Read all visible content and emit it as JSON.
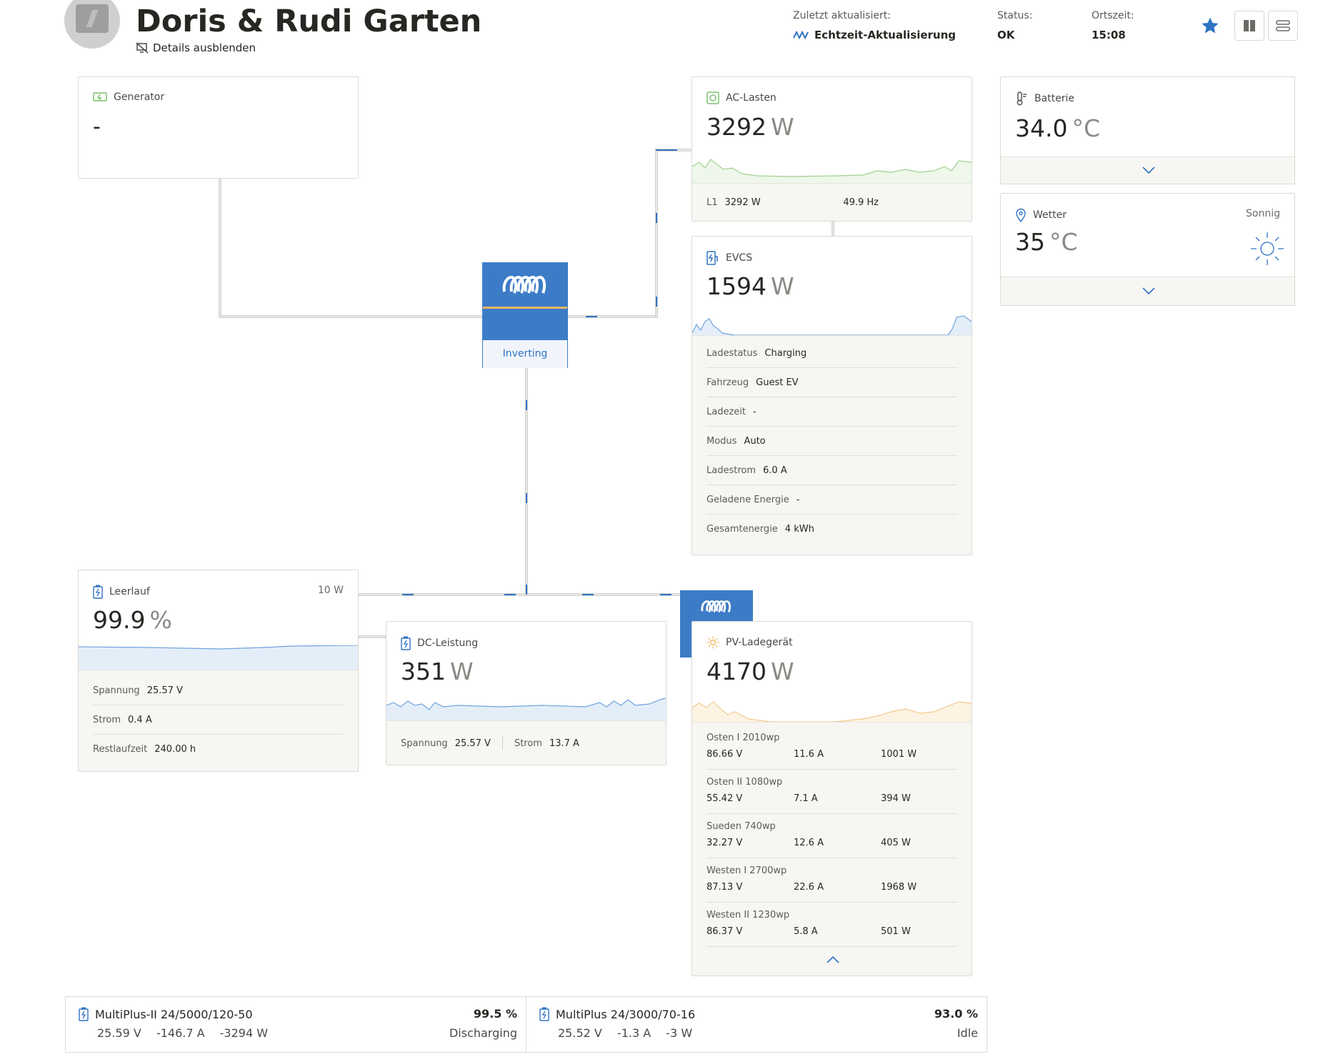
{
  "header": {
    "title": "Doris & Rudi Garten",
    "details_toggle": "Details ausblenden",
    "last_updated_label": "Zuletzt aktualisiert:",
    "last_updated_value": "Echtzeit-Aktualisierung",
    "status_label": "Status:",
    "status_value": "OK",
    "localtime_label": "Ortszeit:",
    "localtime_value": "15:08"
  },
  "generator": {
    "title": "Generator",
    "value": "-"
  },
  "ac_loads": {
    "title": "AC-Lasten",
    "value": "3292",
    "unit": "W",
    "phase_label": "L1",
    "phase_power": "3292 W",
    "frequency": "49.9 Hz"
  },
  "evcs": {
    "title": "EVCS",
    "value": "1594",
    "unit": "W",
    "rows": [
      {
        "k": "Ladestatus",
        "v": "Charging"
      },
      {
        "k": "Fahrzeug",
        "v": "Guest EV"
      },
      {
        "k": "Ladezeit",
        "v": "-"
      },
      {
        "k": "Modus",
        "v": "Auto"
      },
      {
        "k": "Ladestrom",
        "v": "6.0 A"
      },
      {
        "k": "Geladene Energie",
        "v": "-"
      },
      {
        "k": "Gesamtenergie",
        "v": "4 kWh"
      }
    ]
  },
  "inverter": {
    "state": "Inverting"
  },
  "battery_temp": {
    "title": "Batterie",
    "value": "34.0",
    "unit": "°C"
  },
  "weather": {
    "title": "Wetter",
    "condition": "Sonnig",
    "value": "35",
    "unit": "°C"
  },
  "battery": {
    "title": "Leerlauf",
    "power": "10 W",
    "value": "99.9",
    "unit": "%",
    "rows": [
      {
        "k": "Spannung",
        "v": "25.57 V"
      },
      {
        "k": "Strom",
        "v": "0.4 A"
      },
      {
        "k": "Restlaufzeit",
        "v": "240.00 h"
      }
    ]
  },
  "dc_power": {
    "title": "DC-Leistung",
    "value": "351",
    "unit": "W",
    "voltage_label": "Spannung",
    "voltage": "25.57 V",
    "current_label": "Strom",
    "current": "13.7 A"
  },
  "pv_charger": {
    "title": "PV-Ladegerät",
    "value": "4170",
    "unit": "W",
    "trackers": [
      {
        "name": "Osten I 2010wp",
        "voltage": "86.66 V",
        "current": "11.6 A",
        "power": "1001 W"
      },
      {
        "name": "Osten II 1080wp",
        "voltage": "55.42 V",
        "current": "7.1 A",
        "power": "394 W"
      },
      {
        "name": "Sueden 740wp",
        "voltage": "32.27 V",
        "current": "12.6 A",
        "power": "405 W"
      },
      {
        "name": "Westen I 2700wp",
        "voltage": "87.13 V",
        "current": "22.6 A",
        "power": "1968 W"
      },
      {
        "name": "Westen II 1230wp",
        "voltage": "86.37 V",
        "current": "5.8 A",
        "power": "501 W"
      }
    ]
  },
  "devices": [
    {
      "name": "MultiPlus-II 24/5000/120-50",
      "voltage": "25.59 V",
      "current": "-146.7 A",
      "power": "-3294 W",
      "soc": "99.5 %",
      "state": "Discharging"
    },
    {
      "name": "MultiPlus 24/3000/70-16",
      "voltage": "25.52 V",
      "current": "-1.3 A",
      "power": "-3 W",
      "soc": "93.0 %",
      "state": "Idle"
    }
  ],
  "icons": {
    "generator": "generator-icon",
    "ac_loads": "ac-loads-icon",
    "evcs": "ev-charger-icon",
    "battery_temp": "thermometer-icon",
    "weather": "location-pin-icon",
    "battery": "battery-icon",
    "pv": "sun-icon"
  },
  "colors": {
    "accent": "#2f73c4",
    "victron_blue": "#3c7cc7",
    "ok_green": "#7bc26d",
    "pv_orange": "#f0b660",
    "text": "#272622"
  }
}
